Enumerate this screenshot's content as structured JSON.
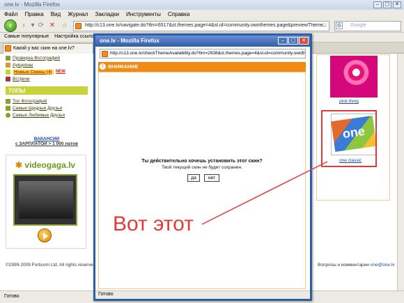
{
  "browser": {
    "title": "one.lv - Mozilla Firefox",
    "menu": [
      "Файл",
      "Правка",
      "Вид",
      "Журнал",
      "Закладки",
      "Инструменты",
      "Справка"
    ],
    "url": "http://c13.one.lv/navigate.do?tlm=6517&st.themes.page=4&st.id=community.ownthemes.page&previewTheme...",
    "search_placeholder": "Google",
    "bookmarks": [
      "Самые популярные",
      "Настройка ссылок"
    ],
    "tab_label": "Какой у вас скин на one.lv?",
    "status": "Готово"
  },
  "left": {
    "items_top": [
      "Проверка Фотографий",
      "Аукционы",
      "Новые Скины (4)",
      "Встречи"
    ],
    "new_badge": "NEW",
    "tops_header": "ТОПЫ",
    "tops_items": [
      "Топ Фотографий",
      "Самые Щедрые Друзья",
      "Самые Любимые Друзья"
    ],
    "vacancies_title": "ВАКАНСИИ",
    "vacancies_text": "с ЗАРПЛАТОЙ > 1 000 латов",
    "videogaga": "videogaga.lv"
  },
  "right": {
    "theme1_label": "pink thing",
    "theme2_label": "one classic",
    "theme2_logo": "one"
  },
  "footer": {
    "copyright": "©1999-2009 Forticom Ltd. All rights reserved.",
    "contact_prefix": "Вопросы и комментарии ",
    "contact_email": "one@one.lv"
  },
  "popup": {
    "title": "one.lv - Mozilla Firefox",
    "url": "http://c13.one.lv/checkThemeAvailability.do?tlm=2938&st.themes.page=4&st.id=community.ownth",
    "warning_header": "ВНИМАНИЕ",
    "question": "Ты действительно хочешь установить этот скин?",
    "subtext": "Твой текущий скин не будет сохранен.",
    "yes_label": "да",
    "no_label": "нет",
    "status": "Готово"
  },
  "annotation": {
    "text": "Вот этот",
    "color": "#e03a3a"
  }
}
